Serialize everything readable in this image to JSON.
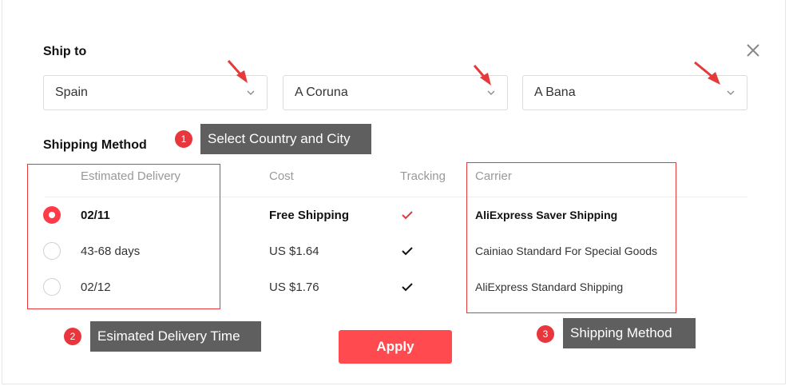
{
  "dialog": {
    "title": "Ship to",
    "close_icon": "close-icon",
    "country": {
      "value": "Spain"
    },
    "province": {
      "value": "A Coruna"
    },
    "city": {
      "value": "A Bana"
    }
  },
  "shipping": {
    "title": "Shipping Method",
    "headers": {
      "delivery": "Estimated Delivery",
      "cost": "Cost",
      "tracking": "Tracking",
      "carrier": "Carrier"
    },
    "rows": [
      {
        "delivery": "02/11",
        "cost": "Free Shipping",
        "tracking": "check-icon",
        "tracking_color": "#e8363c",
        "carrier": "AliExpress Saver Shipping",
        "selected": true
      },
      {
        "delivery": "43-68 days",
        "cost": "US $1.64",
        "tracking": "check-icon",
        "tracking_color": "#111111",
        "carrier": "Cainiao Standard For Special Goods",
        "selected": false
      },
      {
        "delivery": "02/12",
        "cost": "US $1.76",
        "tracking": "check-icon",
        "tracking_color": "#111111",
        "carrier": "AliExpress Standard Shipping",
        "selected": false
      }
    ]
  },
  "annotations": [
    {
      "number": "1",
      "text": "Select Country and City"
    },
    {
      "number": "2",
      "text": "Esimated Delivery Time"
    },
    {
      "number": "3",
      "text": "Shipping Method"
    }
  ],
  "apply_label": "Apply",
  "colors": {
    "accent": "#ff4b4f",
    "annotation_red": "#e53a3a",
    "tooltip_bg": "#5f5f5f"
  }
}
